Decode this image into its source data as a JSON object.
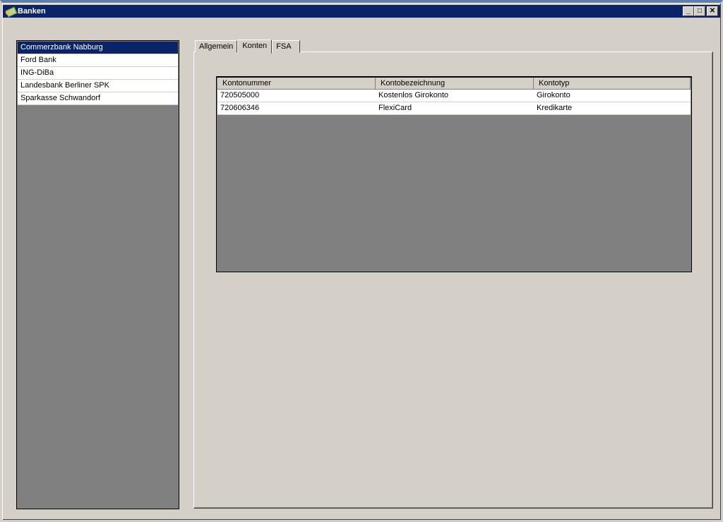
{
  "window": {
    "title": "Banken",
    "minimize": "_",
    "maximize": "□",
    "close": "✕"
  },
  "banks": [
    "Commerzbank Nabburg",
    "Ford Bank",
    "ING-DiBa",
    "Landesbank Berliner SPK",
    "Sparkasse Schwandorf"
  ],
  "tabs": [
    "Allgemein",
    "Konten",
    "FSA"
  ],
  "grid": {
    "columns": [
      "Kontonummer",
      "Kontobezeichnung",
      "Kontotyp"
    ],
    "rows": [
      [
        "720505000",
        "Kostenlos Girokonto",
        "Girokonto"
      ],
      [
        "720606346",
        "FlexiCard",
        "Kredikarte"
      ]
    ]
  },
  "colors": {
    "titlebar": "#0a246a",
    "selection": "#0a246a",
    "background": "#d4d0c8"
  }
}
